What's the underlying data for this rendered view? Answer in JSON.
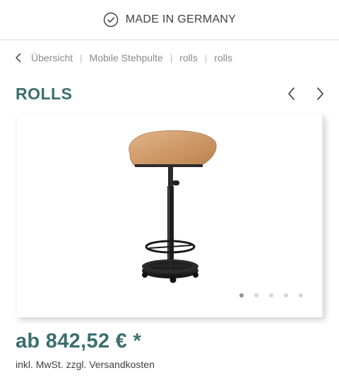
{
  "header": {
    "badge_text": "MADE IN GERMANY",
    "badge_icon": "check-circle-icon"
  },
  "breadcrumb": {
    "back_icon": "chevron-left-icon",
    "items": [
      "Übersicht",
      "Mobile Stehpulte",
      "rolls",
      "rolls"
    ],
    "separator": "|"
  },
  "product": {
    "title": "ROLLS",
    "image": "mobile-standing-desk-image",
    "gallery": {
      "prev_icon": "chevron-left-icon",
      "next_icon": "chevron-right-icon",
      "slide_count": 5,
      "active_slide": 1
    },
    "price": "ab 842,52 € *",
    "tax_note": "inkl. MwSt. zzgl. Versandkosten"
  },
  "colors": {
    "accent": "#3a6f6e",
    "text": "#4a4a4a",
    "muted": "#8a8a8a",
    "dot_active": "#8e93a3",
    "dot_inactive": "#d6d6d6"
  }
}
